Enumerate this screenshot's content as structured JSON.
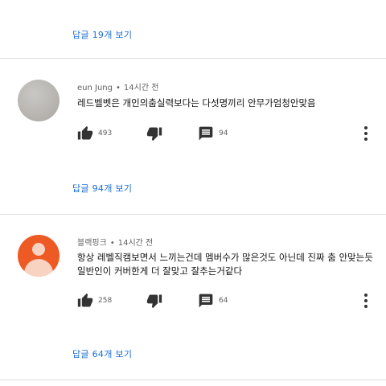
{
  "top_replies_link": "답글 19개 보기",
  "comments": [
    {
      "author": "eun Jung",
      "separator": "•",
      "time": "14시간 전",
      "text": "레드벨벳은 개인의춤실력보다는 다섯명끼리 안무가엄청안맞음",
      "likes": "493",
      "replies_count": "94",
      "replies_link": "답글 94개 보기"
    },
    {
      "author": "블랙핑크",
      "separator": "•",
      "time": "14시간 전",
      "text": "항상 레벨직캠보면서 느끼는건데 멤버수가 많은것도 아닌데 진짜 춤 안맞는듯 일반인이 커버한게 더 잘맞고 잘추는거같다",
      "likes": "258",
      "replies_count": "64",
      "replies_link": "답글 64개 보기"
    }
  ],
  "icons": {
    "like": "thumbs-up-icon",
    "dislike": "thumbs-down-icon",
    "reply": "comment-icon",
    "more": "more-vertical-icon"
  },
  "colors": {
    "link": "#1a6ed8",
    "avatar_orange": "#ee5a24",
    "avatar_grey": "#b9b6b2",
    "icon": "#333333"
  }
}
